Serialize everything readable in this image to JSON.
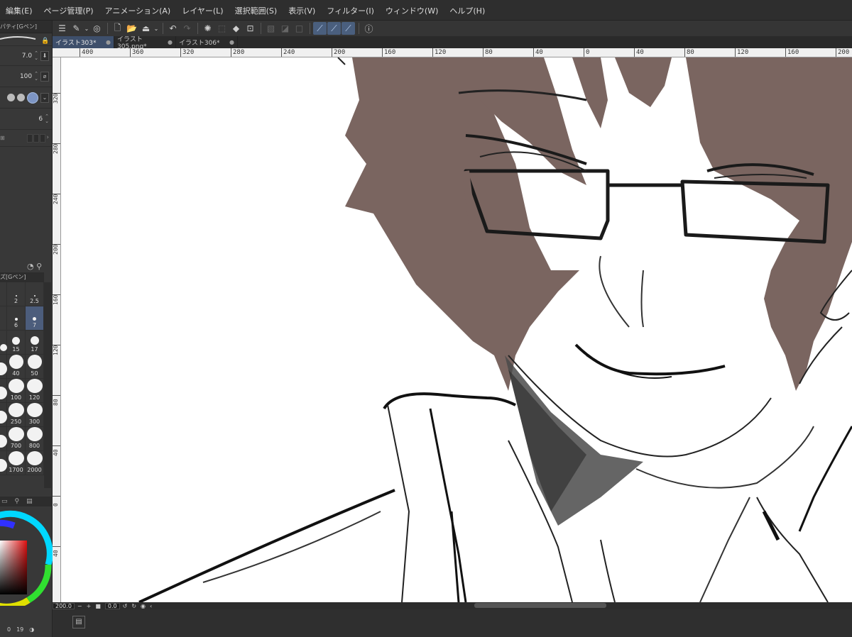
{
  "menu": [
    "編集(E)",
    "ページ管理(P)",
    "アニメーション(A)",
    "レイヤー(L)",
    "選択範囲(S)",
    "表示(V)",
    "フィルター(I)",
    "ウィンドウ(W)",
    "ヘルプ(H)"
  ],
  "toolbar": {
    "icons": [
      "menu-icon",
      "edit-icon",
      "chevron-down-icon",
      "spiral-icon",
      "new-file-icon",
      "open-folder-icon",
      "save-icon",
      "chevron-down-icon",
      "undo-icon",
      "redo-icon",
      "loading-icon",
      "crop-icon",
      "fill-icon",
      "transform-icon",
      "layer-mask-icon",
      "layer-fill-icon",
      "layer-border-icon",
      "stabilizer-1-icon",
      "stabilizer-2-icon",
      "stabilizer-3-icon",
      "help-icon"
    ]
  },
  "tabs": [
    {
      "label": "イラスト303*",
      "active": true
    },
    {
      "label": "イラスト305.png*",
      "active": false
    },
    {
      "label": "イラスト306*",
      "active": false
    }
  ],
  "tool_property": {
    "title": "パティ[Gペン]",
    "brush_size": "7.0",
    "opacity": "100",
    "stabilization": "6"
  },
  "brush_size_panel": {
    "title": "ズ[Gペン]",
    "rows": [
      [
        "2",
        "2.5"
      ],
      [
        "6",
        "7"
      ],
      [
        "15",
        "17"
      ],
      [
        "40",
        "50"
      ],
      [
        "100",
        "120"
      ],
      [
        "250",
        "300"
      ],
      [
        "700",
        "800"
      ],
      [
        "1700",
        "2000"
      ]
    ],
    "selected": "7"
  },
  "color_panel": {
    "values": [
      "0",
      "19"
    ]
  },
  "ruler_h": [
    "400",
    "360",
    "320",
    "280",
    "240",
    "200",
    "160",
    "120",
    "80",
    "40",
    "0",
    "40",
    "80",
    "120",
    "160",
    "200"
  ],
  "ruler_v": [
    "320",
    "280",
    "240",
    "200",
    "160",
    "120",
    "80",
    "40",
    "0",
    "40"
  ],
  "status": {
    "zoom": "200.0",
    "rotation": "0.0"
  },
  "colors": {
    "hair": "#7a6560",
    "line": "#1a1a1a",
    "ui_bg": "#3a3a3a",
    "accent": "#4c5d7c"
  }
}
